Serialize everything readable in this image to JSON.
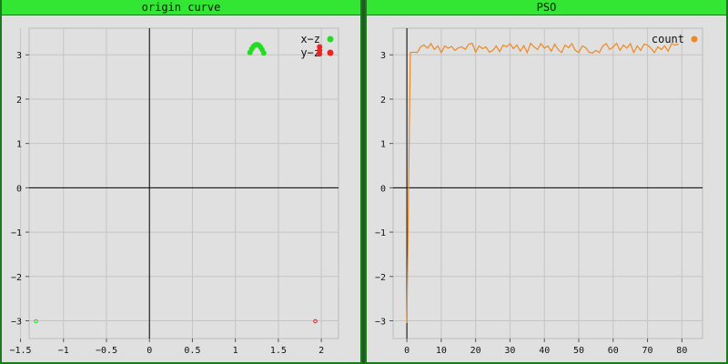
{
  "panels": {
    "left": {
      "title": "origin curve"
    },
    "right": {
      "title": "PSO"
    }
  },
  "colors": {
    "panel_bg": "#e0e0e0",
    "title_bg": "#33e633",
    "grid": "#c4c4c4",
    "axis": "#000000",
    "xz": "#22dd22",
    "yz": "#ee2222",
    "count": "#ee8822"
  },
  "chart_data": [
    {
      "type": "scatter",
      "title": "origin curve",
      "xlim": [
        -1.4,
        2.2
      ],
      "ylim": [
        -3.4,
        3.6
      ],
      "xticks": [
        -1.5,
        -1,
        -0.5,
        0,
        0.5,
        1,
        1.5,
        2
      ],
      "xtick_labels": [
        "−1.5",
        "−1",
        "−0.5",
        "0",
        "0.5",
        "1",
        "1.5",
        "2"
      ],
      "yticks": [
        -3,
        -2,
        -1,
        0,
        1,
        2,
        3
      ],
      "ytick_labels": [
        "−3",
        "−2",
        "−1",
        "0",
        "1",
        "2",
        "3"
      ],
      "grid": true,
      "legend": "top-right",
      "series": [
        {
          "name": "x−z",
          "color": "#22dd22",
          "points": [
            [
              1.17,
              3.05
            ],
            [
              1.19,
              3.13
            ],
            [
              1.21,
              3.19
            ],
            [
              1.23,
              3.22
            ],
            [
              1.25,
              3.23
            ],
            [
              1.27,
              3.22
            ],
            [
              1.29,
              3.18
            ],
            [
              1.31,
              3.12
            ],
            [
              1.33,
              3.04
            ],
            [
              -1.32,
              -3.01
            ]
          ]
        },
        {
          "name": "y−z",
          "color": "#ee2222",
          "points": [
            [
              1.98,
              3.18
            ],
            [
              1.98,
              3.1
            ],
            [
              1.98,
              3.02
            ],
            [
              1.93,
              -3.01
            ]
          ]
        }
      ]
    },
    {
      "type": "line",
      "title": "PSO",
      "xlim": [
        -4,
        86
      ],
      "ylim": [
        -3.4,
        3.6
      ],
      "xticks": [
        0,
        10,
        20,
        30,
        40,
        50,
        60,
        70,
        80
      ],
      "xtick_labels": [
        "0",
        "10",
        "20",
        "30",
        "40",
        "50",
        "60",
        "70",
        "80"
      ],
      "yticks": [
        -3,
        -2,
        -1,
        0,
        1,
        2,
        3
      ],
      "ytick_labels": [
        "−3",
        "−2",
        "−1",
        "0",
        "1",
        "2",
        "3"
      ],
      "grid": true,
      "legend": "top-right",
      "series": [
        {
          "name": "count",
          "color": "#ee8822",
          "x": [
            0,
            1,
            2,
            3,
            4,
            5,
            6,
            7,
            8,
            9,
            10,
            11,
            12,
            13,
            14,
            15,
            16,
            17,
            18,
            19,
            20,
            21,
            22,
            23,
            24,
            25,
            26,
            27,
            28,
            29,
            30,
            31,
            32,
            33,
            34,
            35,
            36,
            37,
            38,
            39,
            40,
            41,
            42,
            43,
            44,
            45,
            46,
            47,
            48,
            49,
            50,
            51,
            52,
            53,
            54,
            55,
            56,
            57,
            58,
            59,
            60,
            61,
            62,
            63,
            64,
            65,
            66,
            67,
            68,
            69,
            70,
            71,
            72,
            73,
            74,
            75,
            76,
            77,
            78,
            79
          ],
          "values": [
            -3.05,
            3.05,
            3.06,
            3.05,
            3.18,
            3.22,
            3.15,
            3.25,
            3.12,
            3.2,
            3.05,
            3.2,
            3.15,
            3.19,
            3.1,
            3.16,
            3.18,
            3.12,
            3.24,
            3.26,
            3.06,
            3.2,
            3.14,
            3.18,
            3.06,
            3.1,
            3.2,
            3.07,
            3.22,
            3.18,
            3.25,
            3.14,
            3.22,
            3.08,
            3.21,
            3.05,
            3.26,
            3.18,
            3.12,
            3.25,
            3.15,
            3.2,
            3.08,
            3.24,
            3.12,
            3.05,
            3.22,
            3.16,
            3.25,
            3.1,
            3.05,
            3.2,
            3.16,
            3.06,
            3.04,
            3.1,
            3.05,
            3.2,
            3.25,
            3.12,
            3.18,
            3.26,
            3.1,
            3.22,
            3.15,
            3.25,
            3.05,
            3.2,
            3.1,
            3.24,
            3.22,
            3.15,
            3.05,
            3.18,
            3.12,
            3.2,
            3.08,
            3.25,
            3.22,
            3.24
          ]
        }
      ]
    }
  ]
}
